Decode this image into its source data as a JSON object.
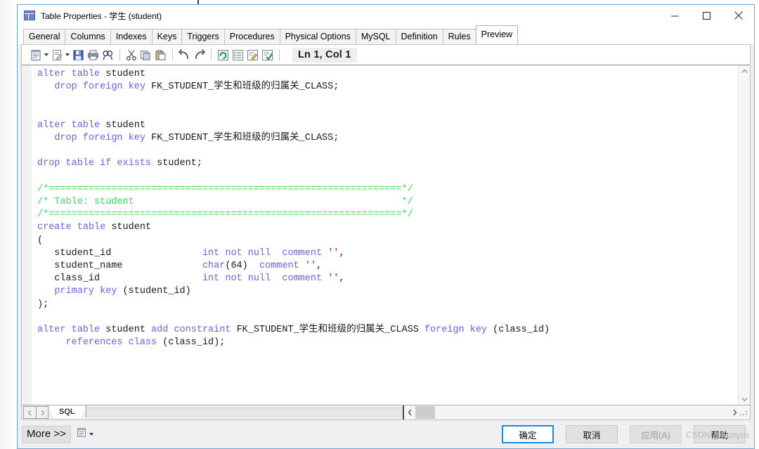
{
  "window": {
    "title": "Table Properties - 学生 (student)",
    "icon": "table-icon",
    "controls": {
      "minimize": "minimize-icon",
      "maximize": "maximize-icon",
      "close": "close-icon"
    }
  },
  "tabs": [
    {
      "label": "General",
      "active": false
    },
    {
      "label": "Columns",
      "active": false
    },
    {
      "label": "Indexes",
      "active": false
    },
    {
      "label": "Keys",
      "active": false
    },
    {
      "label": "Triggers",
      "active": false
    },
    {
      "label": "Procedures",
      "active": false
    },
    {
      "label": "Physical Options",
      "active": false
    },
    {
      "label": "MySQL",
      "active": false
    },
    {
      "label": "Definition",
      "active": false
    },
    {
      "label": "Rules",
      "active": false
    },
    {
      "label": "Preview",
      "active": true
    }
  ],
  "toolbar": {
    "items": [
      "new-script-icon",
      "open-script-icon",
      "save-icon",
      "print-icon",
      "find-icon",
      "cut-icon",
      "copy-icon",
      "paste-icon",
      "undo-icon",
      "redo-icon",
      "refresh-icon",
      "list-icon",
      "edit-icon",
      "check-icon"
    ],
    "position_indicator": "Ln 1, Col 1"
  },
  "editor": {
    "lines": [
      [
        {
          "t": "alter table",
          "c": "kw"
        },
        {
          "t": " student",
          "c": "id"
        }
      ],
      [
        {
          "t": "   ",
          "c": "id"
        },
        {
          "t": "drop foreign key",
          "c": "kw"
        },
        {
          "t": " FK_STUDENT_学生和班级的归属关_CLASS;",
          "c": "id"
        }
      ],
      [],
      [],
      [
        {
          "t": "alter table",
          "c": "kw"
        },
        {
          "t": " student",
          "c": "id"
        }
      ],
      [
        {
          "t": "   ",
          "c": "id"
        },
        {
          "t": "drop foreign key",
          "c": "kw"
        },
        {
          "t": " FK_STUDENT_学生和班级的归属关_CLASS;",
          "c": "id"
        }
      ],
      [],
      [
        {
          "t": "drop table if exists",
          "c": "kw"
        },
        {
          "t": " student;",
          "c": "id"
        }
      ],
      [],
      [
        {
          "t": "/*==============================================================*/",
          "c": "cmt"
        }
      ],
      [
        {
          "t": "/* Table: student                                               */",
          "c": "cmt"
        }
      ],
      [
        {
          "t": "/*==============================================================*/",
          "c": "cmt"
        }
      ],
      [
        {
          "t": "create table",
          "c": "kw"
        },
        {
          "t": " student",
          "c": "id"
        }
      ],
      [
        {
          "t": "(",
          "c": "id"
        }
      ],
      [
        {
          "t": "   student_id                ",
          "c": "id"
        },
        {
          "t": "int not null",
          "c": "kw"
        },
        {
          "t": "  ",
          "c": "id"
        },
        {
          "t": "comment",
          "c": "kw"
        },
        {
          "t": " ",
          "c": "id"
        },
        {
          "t": "''",
          "c": "str"
        },
        {
          "t": ",",
          "c": "id"
        }
      ],
      [
        {
          "t": "   student_name              ",
          "c": "id"
        },
        {
          "t": "char",
          "c": "kw"
        },
        {
          "t": "(64)  ",
          "c": "id"
        },
        {
          "t": "comment",
          "c": "kw"
        },
        {
          "t": " ",
          "c": "id"
        },
        {
          "t": "''",
          "c": "str"
        },
        {
          "t": ",",
          "c": "id"
        }
      ],
      [
        {
          "t": "   class_id                  ",
          "c": "id"
        },
        {
          "t": "int not null",
          "c": "kw"
        },
        {
          "t": "  ",
          "c": "id"
        },
        {
          "t": "comment",
          "c": "kw"
        },
        {
          "t": " ",
          "c": "id"
        },
        {
          "t": "''",
          "c": "str"
        },
        {
          "t": ",",
          "c": "id"
        }
      ],
      [
        {
          "t": "   ",
          "c": "id"
        },
        {
          "t": "primary key",
          "c": "kw"
        },
        {
          "t": " (student_id)",
          "c": "id"
        }
      ],
      [
        {
          "t": ");",
          "c": "id"
        }
      ],
      [],
      [
        {
          "t": "alter table",
          "c": "kw"
        },
        {
          "t": " student ",
          "c": "id"
        },
        {
          "t": "add constraint",
          "c": "kw"
        },
        {
          "t": " FK_STUDENT_学生和班级的归属关_CLASS ",
          "c": "id"
        },
        {
          "t": "foreign key",
          "c": "kw"
        },
        {
          "t": " (class_id)",
          "c": "id"
        }
      ],
      [
        {
          "t": "     ",
          "c": "id"
        },
        {
          "t": "references class",
          "c": "kw"
        },
        {
          "t": " (class_id);",
          "c": "id"
        }
      ]
    ]
  },
  "sheet": {
    "prev_icon": "prev-arrow-icon",
    "next_icon": "next-arrow-icon",
    "tab_label": "SQL"
  },
  "scrollbars": {
    "v_up": "scroll-up-icon",
    "v_down": "scroll-down-icon",
    "h_left": "scroll-left-icon",
    "h_right": "scroll-right-icon"
  },
  "footer": {
    "more_label": "More >>",
    "script_icon": "script-icon",
    "buttons": [
      {
        "label": "确定",
        "state": "default-focused",
        "name": "ok-button"
      },
      {
        "label": "取消",
        "state": "normal",
        "name": "cancel-button"
      },
      {
        "label": "应用(A)",
        "state": "disabled",
        "name": "apply-button"
      },
      {
        "label": "帮助",
        "state": "normal",
        "name": "help-button"
      }
    ],
    "watermark": "CSDN @kunyus"
  },
  "colors": {
    "keyword": "#6464e6",
    "string": "#e02020",
    "comment": "#33dd55",
    "identifier": "#1a1a1a",
    "accent": "#1e87e0",
    "dialog_bg": "#f0f0f0",
    "window_border": "#6ba6d6"
  }
}
